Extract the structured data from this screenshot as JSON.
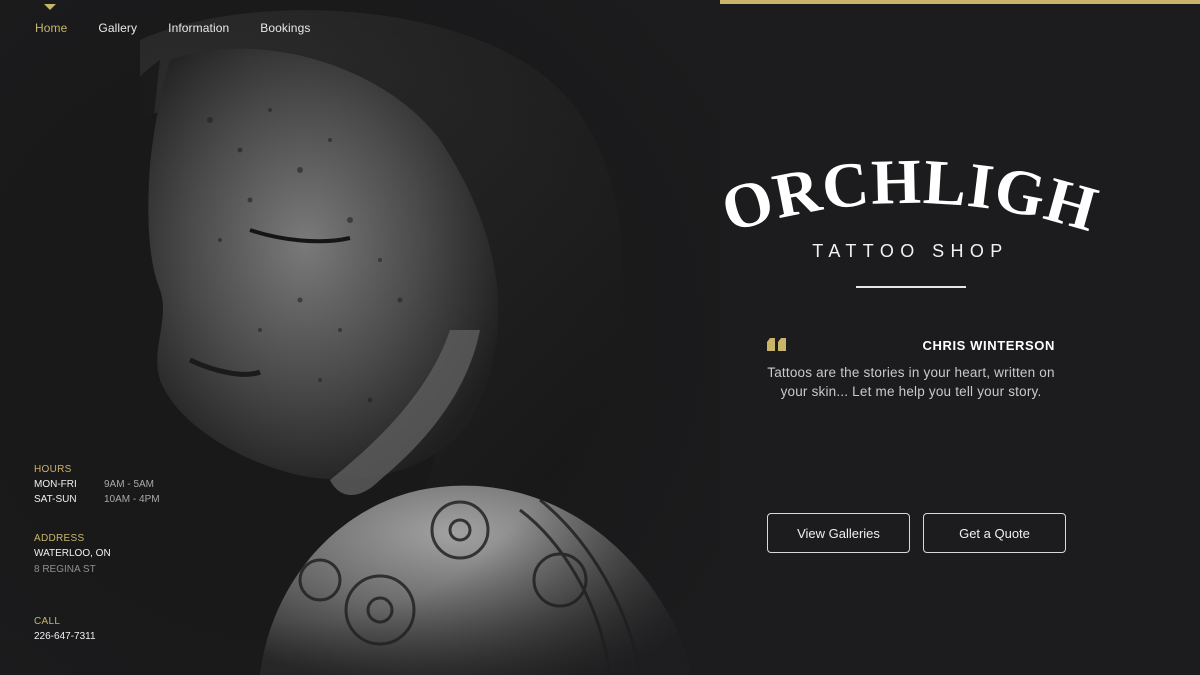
{
  "nav": {
    "items": [
      {
        "label": "Home",
        "active": true
      },
      {
        "label": "Gallery",
        "active": false
      },
      {
        "label": "Information",
        "active": false
      },
      {
        "label": "Bookings",
        "active": false
      }
    ]
  },
  "brand": {
    "name": "TORCHLIGHT",
    "subtitle": "TATTOO SHOP"
  },
  "quote": {
    "author": "CHRIS WINTERSON",
    "text": "Tattoos are the stories in your heart, written on your skin... Let me help you tell your story."
  },
  "buttons": {
    "galleries": "View Galleries",
    "quote": "Get a Quote"
  },
  "info": {
    "hours_label": "HOURS",
    "hours": [
      {
        "day": "MON-FRI",
        "time": "9AM - 5AM"
      },
      {
        "day": "SAT-SUN",
        "time": "10AM - 4PM"
      }
    ],
    "address_label": "ADDRESS",
    "address_city": "WATERLOO, ON",
    "address_street": "8 REGINA ST",
    "call_label": "CALL",
    "phone": "226-647-7311"
  },
  "colors": {
    "accent": "#c8b56a",
    "background": "#1c1c1e",
    "text": "#f0f0f0"
  }
}
